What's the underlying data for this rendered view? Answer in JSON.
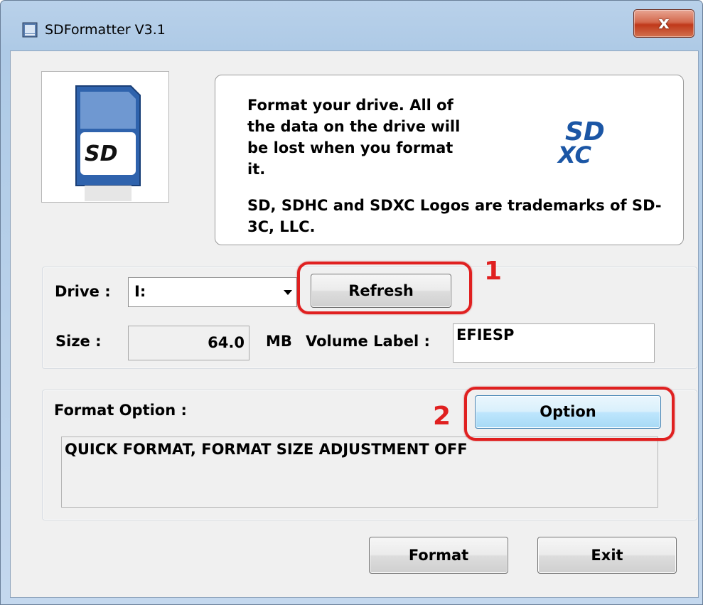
{
  "window": {
    "title": "SDFormatter V3.1",
    "close_glyph": "x"
  },
  "info": {
    "message": "Format your drive. All of the data on the drive will be lost when you format it.",
    "trademark": "SD, SDHC and SDXC Logos are trademarks of SD-3C, LLC."
  },
  "drive": {
    "label": "Drive :",
    "selected": "I:",
    "refresh_label": "Refresh",
    "size_label": "Size :",
    "size_value": "64.0",
    "size_unit": "MB",
    "volume_label_label": "Volume Label :",
    "volume_label_value": "EFIESP"
  },
  "format_option": {
    "label": "Format Option :",
    "option_button": "Option",
    "status": "QUICK FORMAT, FORMAT SIZE ADJUSTMENT OFF"
  },
  "buttons": {
    "format": "Format",
    "exit": "Exit"
  },
  "annotations": {
    "one": "1",
    "two": "2",
    "color": "#e02020"
  },
  "colors": {
    "window_frame": "#b9d1ea",
    "dialog_bg": "#f0f0f0",
    "close_button": "#c0391a",
    "option_button": "#bee6fd",
    "sd_card_blue": "#1b56a5"
  }
}
